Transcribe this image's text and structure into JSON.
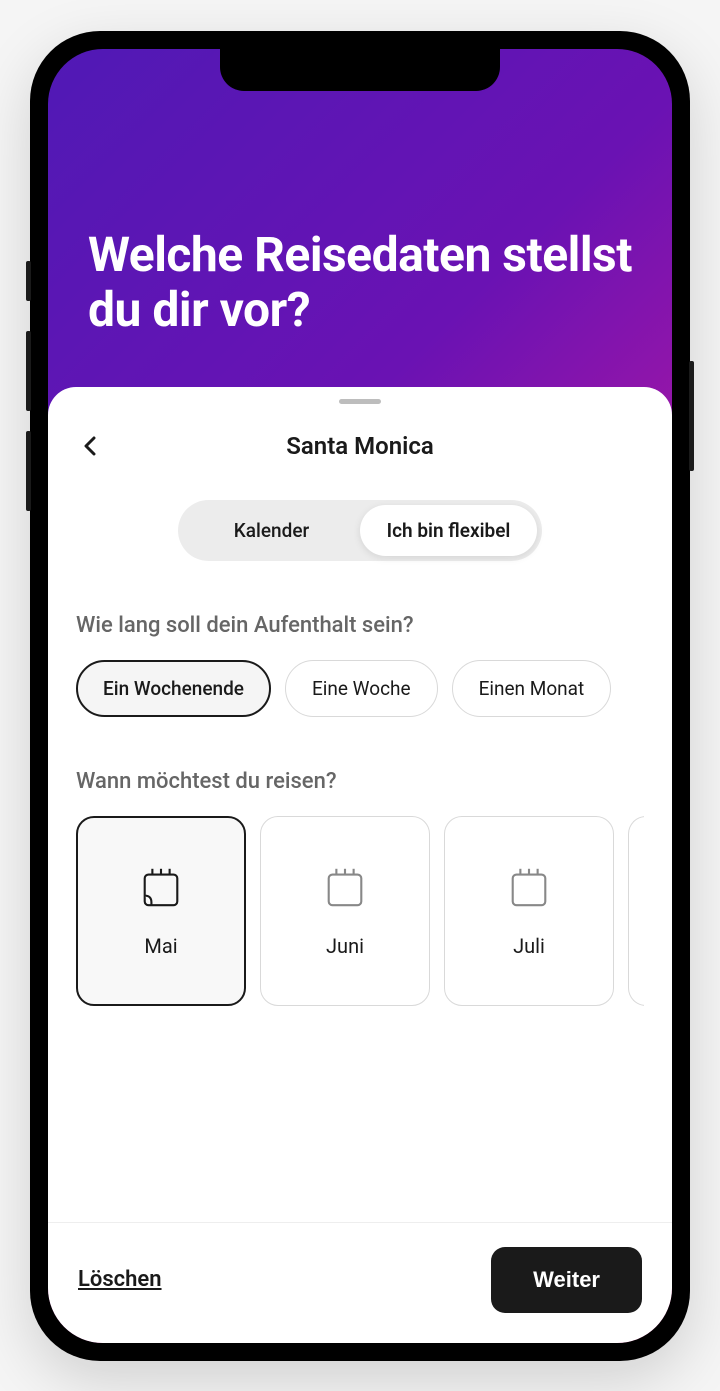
{
  "headline": "Welche Reisedaten stellst du dir vor?",
  "sheet": {
    "title": "Santa Monica",
    "tabs": {
      "calendar": "Kalender",
      "flexible": "Ich bin flexibel",
      "active": "flexible"
    },
    "duration": {
      "label": "Wie lang soll dein Aufenthalt sein?",
      "options": [
        "Ein Wochenende",
        "Eine Woche",
        "Einen Monat"
      ],
      "selected": 0
    },
    "months": {
      "label": "Wann möchtest du reisen?",
      "options": [
        "Mai",
        "Juni",
        "Juli"
      ],
      "selected": 0
    }
  },
  "footer": {
    "clear": "Löschen",
    "next": "Weiter"
  }
}
